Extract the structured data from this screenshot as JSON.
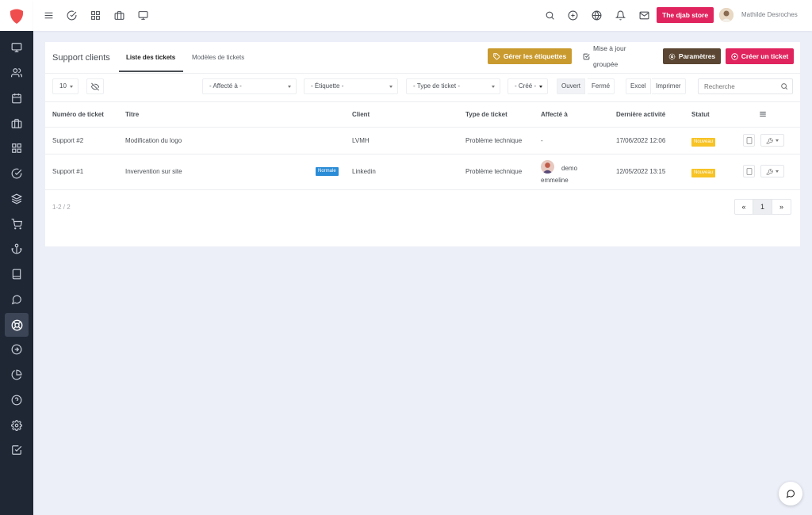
{
  "app": {
    "store_label": "The djab store",
    "user_name": "Mathilde Desroches",
    "colors": {
      "sidebar": "#1f2735",
      "brand": "#e0245e",
      "labels_btn": "#c99a2e",
      "settings_btn": "#5a4632",
      "status_new": "#f7c325",
      "priority_badge": "#2a8bd6"
    }
  },
  "sidebar": {
    "items": [
      {
        "icon": "monitor-icon"
      },
      {
        "icon": "users-icon"
      },
      {
        "icon": "calendar-icon"
      },
      {
        "icon": "briefcase-icon"
      },
      {
        "icon": "grid-icon"
      },
      {
        "icon": "check-circle-icon"
      },
      {
        "icon": "layers-icon"
      },
      {
        "icon": "cart-icon"
      },
      {
        "icon": "anchor-icon"
      },
      {
        "icon": "book-icon"
      },
      {
        "icon": "message-icon"
      },
      {
        "icon": "lifebuoy-icon",
        "active": true
      },
      {
        "icon": "arrow-right-circle-icon"
      },
      {
        "icon": "pie-chart-icon"
      },
      {
        "icon": "help-icon"
      },
      {
        "icon": "settings-icon"
      },
      {
        "icon": "check-square-icon"
      }
    ]
  },
  "header": {
    "page_title": "Support clients",
    "tabs": [
      {
        "label": "Liste des tickets",
        "active": true
      },
      {
        "label": "Modèles de tickets",
        "active": false
      }
    ],
    "buttons": {
      "manage_labels": "Gérer les étiquettes",
      "bulk_update": "Mise à jour groupée",
      "settings": "Paramètres",
      "create_ticket": "Créer un ticket"
    }
  },
  "filters": {
    "page_size": "10",
    "assigned_to": "- Affecté à -",
    "label": "- Étiquette -",
    "ticket_type": "- Type de ticket -",
    "created": "- Créé -",
    "open": "Ouvert",
    "closed": "Fermé",
    "excel": "Excel",
    "print": "Imprimer",
    "search_placeholder": "Recherche"
  },
  "table": {
    "columns": [
      "Numéro de ticket",
      "Titre",
      "Client",
      "Type de ticket",
      "Affecté à",
      "Dernière activité",
      "Statut"
    ],
    "rows": [
      {
        "number": "Support #2",
        "title": "Modification du logo",
        "priority": "",
        "client": "LVMH",
        "type": "Problème technique",
        "assignee": "-",
        "last_activity": "17/06/2022 12:06",
        "status": "Nouveau"
      },
      {
        "number": "Support #1",
        "title": "Invervention sur site",
        "priority": "Normale",
        "client": "Linkedin",
        "type": "Problème technique",
        "assignee": "demo emmeline",
        "last_activity": "12/05/2022 13:15",
        "status": "Nouveau"
      }
    ]
  },
  "pagination": {
    "info": "1-2 / 2",
    "first": "«",
    "page": "1",
    "last": "»"
  }
}
